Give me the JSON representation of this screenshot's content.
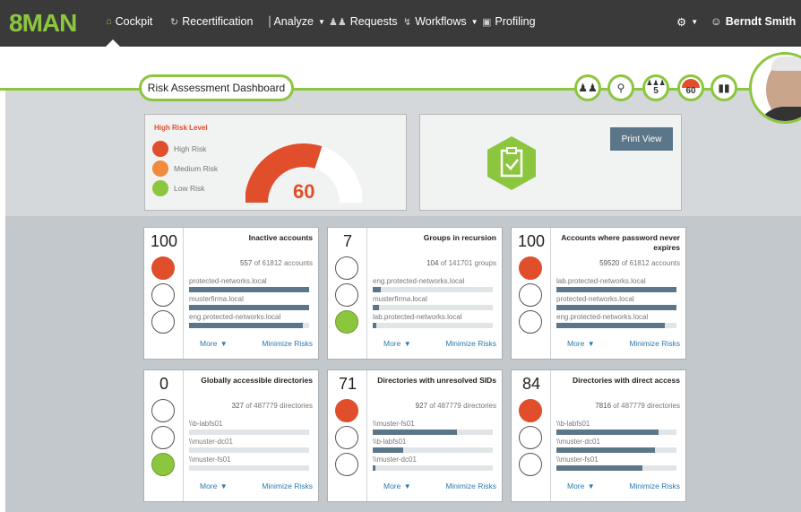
{
  "app": {
    "logo": "8MAN"
  },
  "nav": {
    "items": [
      {
        "label": "Cockpit",
        "active": true,
        "icon": "home-icon"
      },
      {
        "label": "Recertification",
        "icon": "refresh-icon"
      },
      {
        "label": "Analyze",
        "icon": "bar-chart-icon",
        "dropdown": true
      },
      {
        "label": "Requests",
        "icon": "users-icon"
      },
      {
        "label": "Workflows",
        "icon": "workflow-icon",
        "dropdown": true
      },
      {
        "label": "Profiling",
        "icon": "profile-card-icon"
      }
    ],
    "settings_icon": "gear-icon",
    "user_name": "Berndt Smith"
  },
  "header": {
    "title": "Risk Assessment Dashboard",
    "buttons": [
      {
        "name": "groups-icon"
      },
      {
        "name": "search-icon"
      },
      {
        "name": "users-count",
        "value": "5"
      },
      {
        "name": "risk-score",
        "value": "60"
      },
      {
        "name": "chart-icon"
      }
    ]
  },
  "risk_panel": {
    "title": "High Risk Level",
    "legend": [
      {
        "label": "High Risk",
        "color": "#e04e2b"
      },
      {
        "label": "Medium Risk",
        "color": "#f08a3c"
      },
      {
        "label": "Low Risk",
        "color": "#8cc63f"
      }
    ],
    "gauge_value": "60",
    "gauge_fraction": 0.6
  },
  "print_panel": {
    "print_label": "Print View"
  },
  "cards": [
    {
      "score": "100",
      "title": "Inactive accounts",
      "count_a": "557",
      "count_sep": "of",
      "count_b": "61812 accounts",
      "level": "red",
      "rows": [
        {
          "label": "protected-networks.local",
          "fill": 1.0
        },
        {
          "label": "musterfirma.local",
          "fill": 1.0
        },
        {
          "label": "eng.protected-networks.local",
          "fill": 0.95
        }
      ],
      "more": "More",
      "minimize": "Minimize Risks"
    },
    {
      "score": "7",
      "title": "Groups in recursion",
      "count_a": "104",
      "count_sep": "of",
      "count_b": "141701 groups",
      "level": "green",
      "rows": [
        {
          "label": "eng.protected-networks.local",
          "fill": 0.07
        },
        {
          "label": "musterfirma.local",
          "fill": 0.05
        },
        {
          "label": "lab.protected-networks.local",
          "fill": 0.03
        }
      ],
      "more": "More",
      "minimize": "Minimize Risks"
    },
    {
      "score": "100",
      "title": "Accounts where password never expires",
      "count_a": "59520",
      "count_sep": "of",
      "count_b": "61812 accounts",
      "level": "red",
      "rows": [
        {
          "label": "lab.protected-networks.local",
          "fill": 1.0
        },
        {
          "label": "protected-networks.local",
          "fill": 1.0
        },
        {
          "label": "eng.protected-networks.local",
          "fill": 0.9
        }
      ],
      "more": "More",
      "minimize": "Minimize Risks"
    },
    {
      "score": "0",
      "title": "Globally accessible directories",
      "count_a": "327",
      "count_sep": "of",
      "count_b": "487779 directories",
      "level": "green",
      "rows": [
        {
          "label": "\\\\b-labfs01",
          "fill": 0.0
        },
        {
          "label": "\\\\muster-dc01",
          "fill": 0.0
        },
        {
          "label": "\\\\muster-fs01",
          "fill": 0.0
        }
      ],
      "more": "More",
      "minimize": "Minimize Risks"
    },
    {
      "score": "71",
      "title": "Directories with unresolved SIDs",
      "count_a": "927",
      "count_sep": "of",
      "count_b": "487779 directories",
      "level": "red",
      "rows": [
        {
          "label": "\\\\muster-fs01",
          "fill": 0.7
        },
        {
          "label": "\\\\b-labfs01",
          "fill": 0.25
        },
        {
          "label": "\\\\muster-dc01",
          "fill": 0.02
        }
      ],
      "more": "More",
      "minimize": "Minimize Risks"
    },
    {
      "score": "84",
      "title": "Directories with direct access",
      "count_a": "7816",
      "count_sep": "of",
      "count_b": "487779 directories",
      "level": "red",
      "rows": [
        {
          "label": "\\\\b-labfs01",
          "fill": 0.85
        },
        {
          "label": "\\\\muster-dc01",
          "fill": 0.82
        },
        {
          "label": "\\\\muster-fs01",
          "fill": 0.72
        }
      ],
      "more": "More",
      "minimize": "Minimize Risks"
    }
  ]
}
